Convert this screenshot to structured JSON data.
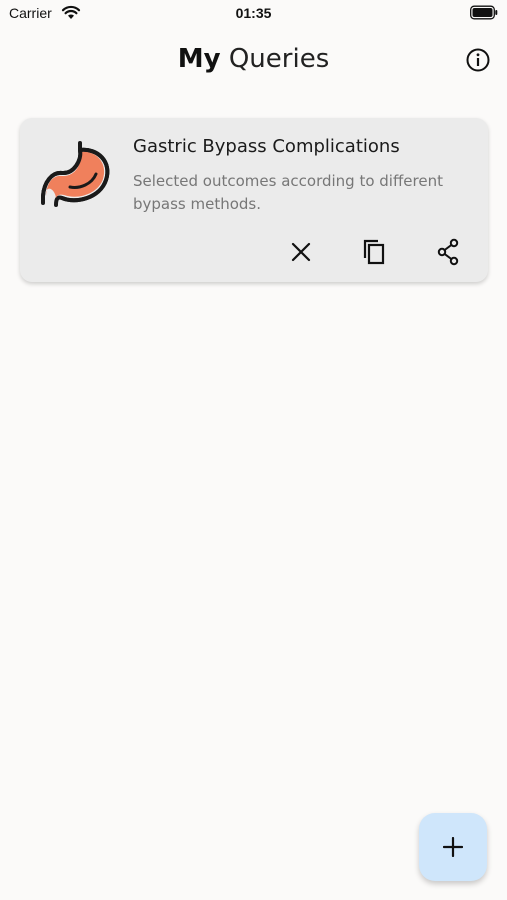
{
  "status_bar": {
    "carrier": "Carrier",
    "time": "01:35"
  },
  "header": {
    "title_bold": "My",
    "title_light": "Queries"
  },
  "queries": [
    {
      "title": "Gastric Bypass Complications",
      "description": "Selected outcomes according to different bypass methods.",
      "icon": "stomach-icon"
    }
  ],
  "actions": {
    "remove_icon": "close-icon",
    "copy_icon": "copy-icon",
    "share_icon": "share-icon",
    "add_icon": "plus-icon"
  },
  "colors": {
    "background": "#fbfaf9",
    "card": "#ebebeb",
    "stomach_fill": "#f0805c",
    "fab": "#cfe6fb"
  }
}
